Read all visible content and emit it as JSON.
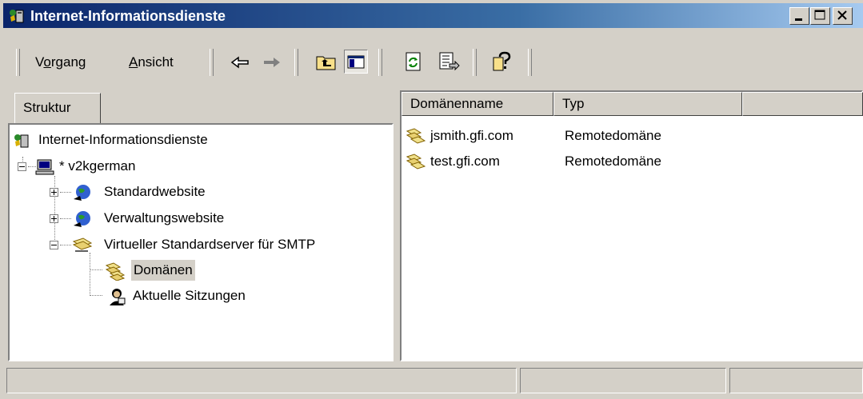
{
  "window": {
    "title": "Internet-Informationsdienste"
  },
  "menu": {
    "vorgang": {
      "pre": "V",
      "u": "o",
      "post": "rgang"
    },
    "ansicht": {
      "pre": "",
      "u": "A",
      "post": "nsicht"
    }
  },
  "toolbar": {
    "icons": [
      "back-arrow-icon",
      "forward-arrow-icon",
      "up-folder-icon",
      "show-tree-icon",
      "refresh-icon",
      "export-list-icon",
      "help-icon"
    ]
  },
  "left_pane": {
    "tab_label": "Struktur",
    "tree": [
      {
        "label": "Internet-Informationsdienste",
        "icon": "iis-icon",
        "expander": "none"
      },
      {
        "label": "* v2kgerman",
        "icon": "computer-icon",
        "expander": "minus"
      },
      {
        "label": "Standardwebsite",
        "icon": "website-globe-icon",
        "expander": "plus"
      },
      {
        "label": "Verwaltungswebsite",
        "icon": "website-globe-icon",
        "expander": "plus"
      },
      {
        "label": "Virtueller Standardserver für SMTP",
        "icon": "smtp-server-icon",
        "expander": "minus"
      },
      {
        "label": "Domänen",
        "icon": "domains-icon",
        "expander": "none",
        "selected": true
      },
      {
        "label": "Aktuelle Sitzungen",
        "icon": "sessions-icon",
        "expander": "none"
      }
    ]
  },
  "right_pane": {
    "columns": [
      "Domänenname",
      "Typ",
      ""
    ],
    "rows": [
      {
        "name": "jsmith.gfi.com",
        "type": "Remotedomäne"
      },
      {
        "name": "test.gfi.com",
        "type": "Remotedomäne"
      }
    ]
  },
  "status_bar": {
    "panels": [
      "",
      "",
      ""
    ]
  }
}
